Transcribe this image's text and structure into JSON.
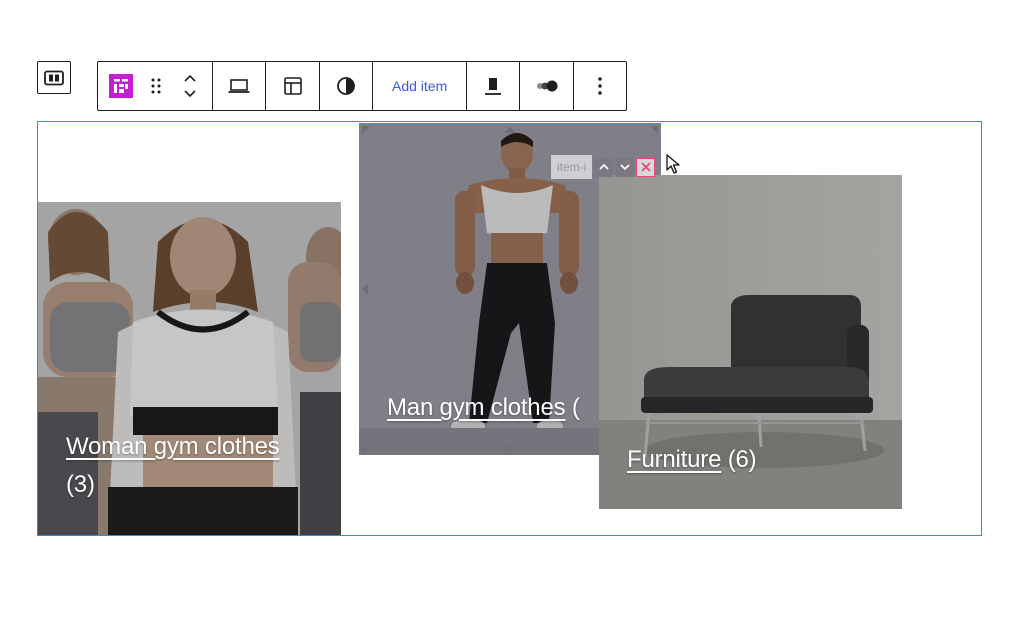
{
  "toolbar": {
    "add_item_label": "Add item",
    "accent_color": "#c11fd1"
  },
  "cards": [
    {
      "title": "Woman gym clothes",
      "count": "(3)"
    },
    {
      "title": "Man gym clothes",
      "count": "("
    },
    {
      "title": "Furniture",
      "count": "(6)"
    }
  ],
  "item_control": {
    "label": "item-i"
  },
  "icons": {
    "parent": "parent-block-icon",
    "block": "grid-block-icon",
    "drag": "drag-handle-icon",
    "move": "chevron-up-down-icon",
    "device": "laptop-icon",
    "layout": "layout-icon",
    "contrast": "half-circle-icon",
    "align": "align-bottom-icon",
    "toggle": "toggle-icon",
    "more": "more-vertical-icon"
  }
}
